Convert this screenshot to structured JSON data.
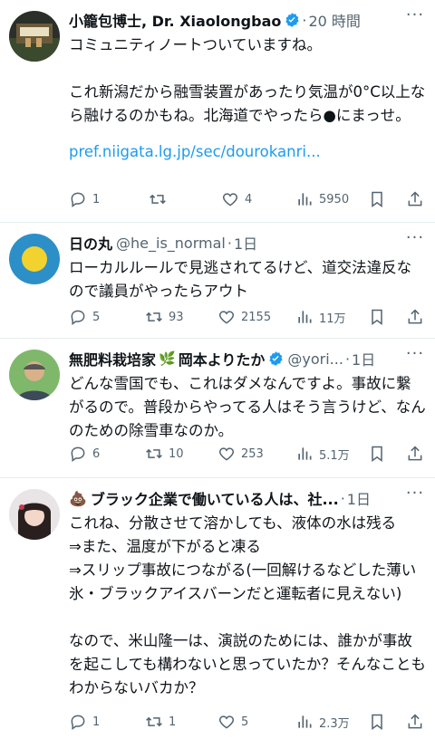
{
  "posts": [
    {
      "name": "小籠包博士, Dr. Xiaolongbao",
      "handle": "",
      "time": "20 時間",
      "verified": true,
      "text": "コミュニティノートついていますね。\n\nこれ新潟だから融雪装置があったり気温が0°C以上なら融けるのかもね。北海道でやったら●にまっせ。",
      "link": "pref.niigata.lg.jp/sec/dourokanri...",
      "stats": {
        "replies": "1",
        "reposts": "",
        "likes": "4",
        "views": "5950"
      }
    },
    {
      "name": "日の丸",
      "handle": "@he_is_normal",
      "time": "1日",
      "verified": false,
      "text": "ローカルルールで見逃されてるけど、道交法違反なので議員がやったらアウト",
      "stats": {
        "replies": "5",
        "reposts": "93",
        "likes": "2155",
        "views": "11万"
      }
    },
    {
      "name": "無肥料栽培家",
      "name2": "岡本よりたか",
      "handle": "@yori...",
      "time": "1日",
      "verified": true,
      "text": "どんな雪国でも、これはダメなんですよ。事故に繋がるので。普段からやってる人はそう言うけど、なんのための除雪車なのか。",
      "stats": {
        "replies": "6",
        "reposts": "10",
        "likes": "253",
        "views": "5.1万"
      }
    },
    {
      "name_prefix": "💩",
      "name": "ブラック企業で働いている人は、社...",
      "handle": "",
      "time": "1日",
      "verified": false,
      "text": "これね、分散させて溶かしても、液体の水は残る\n⇒また、温度が下がると凍る\n⇒スリップ事故につながる(一回解けるなどした薄い氷・ブラックアイスバーンだと運転者に見えない)\n\nなので、米山隆一は、演説のためには、誰かが事故を起こしても構わないと思っていたか？そんなこともわからないバカか？",
      "stats": {
        "replies": "1",
        "reposts": "1",
        "likes": "5",
        "views": "2.3万"
      }
    }
  ],
  "colors": {
    "accent": "#1d9bf0",
    "muted": "#536471",
    "text": "#0f1419"
  }
}
